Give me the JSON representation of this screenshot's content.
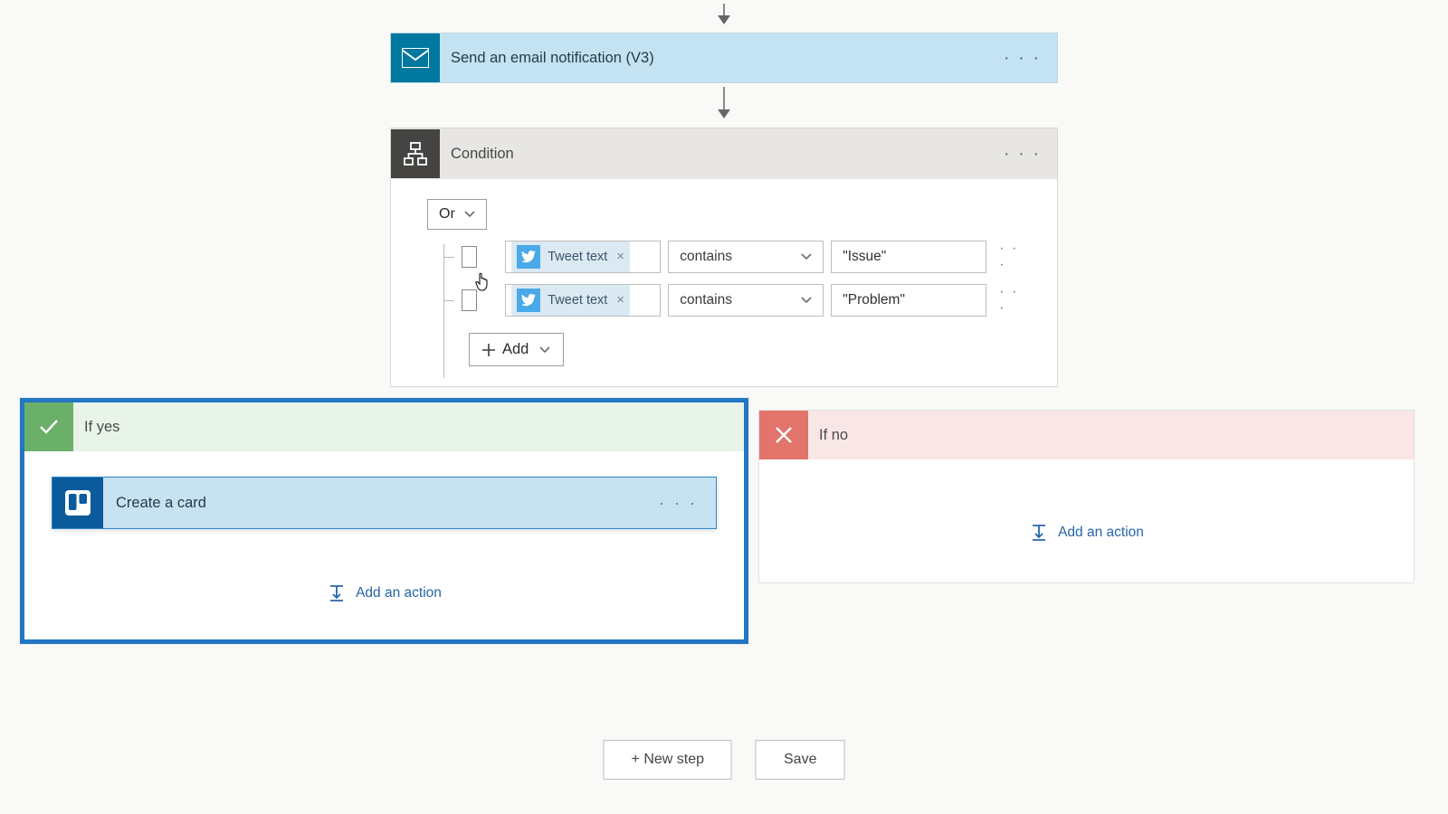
{
  "email_step": {
    "title": "Send an email notification (V3)"
  },
  "condition": {
    "title": "Condition",
    "group_operator": "Or",
    "add_label": "Add",
    "rows": [
      {
        "token_label": "Tweet text",
        "operator": "contains",
        "value": "\"Issue\""
      },
      {
        "token_label": "Tweet text",
        "operator": "contains",
        "value": "\"Problem\""
      }
    ]
  },
  "branch_yes": {
    "title": "If yes",
    "action_title": "Create a card",
    "add_action_label": "Add an action"
  },
  "branch_no": {
    "title": "If no",
    "add_action_label": "Add an action"
  },
  "footer": {
    "new_step": "+ New step",
    "save": "Save"
  }
}
